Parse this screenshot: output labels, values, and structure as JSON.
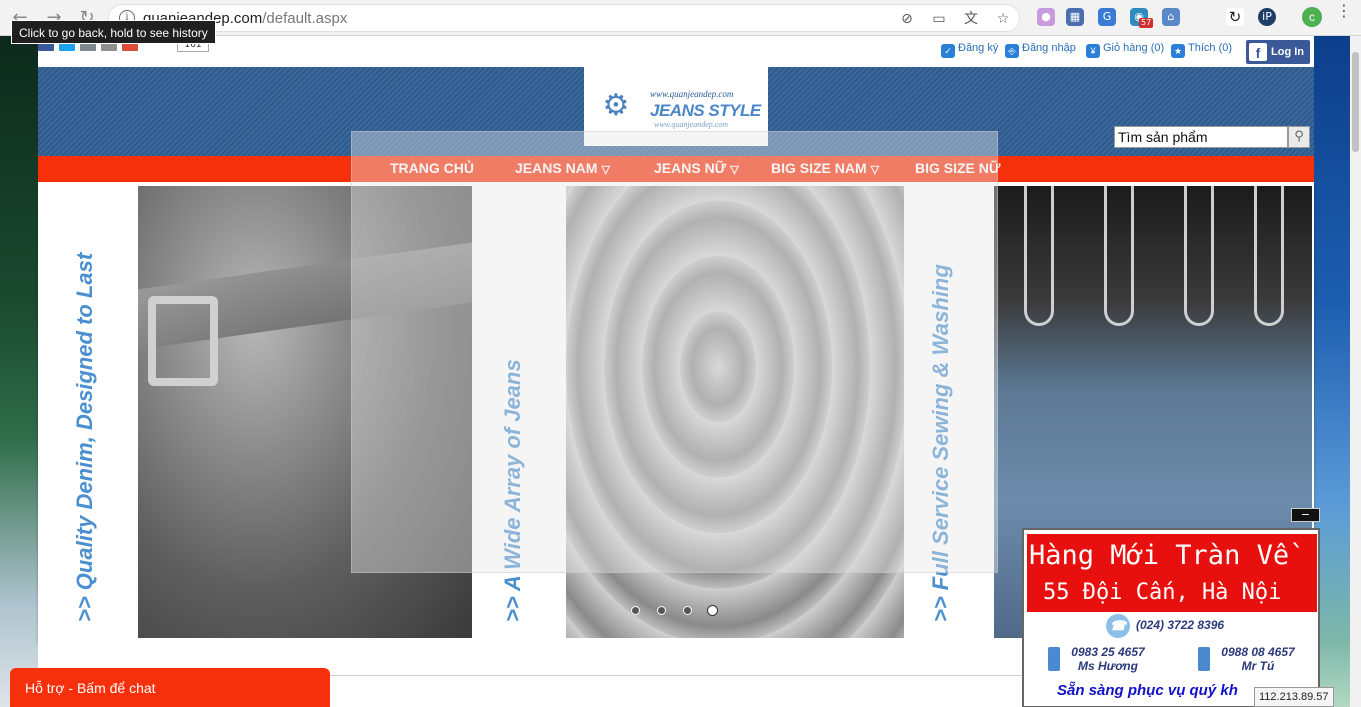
{
  "browser": {
    "url_domain": "quanjeandep.com",
    "url_path": "/default.aspx",
    "tooltip": "Click to go back, hold to see history",
    "profile_initial": "c",
    "ext_badge": "57"
  },
  "topbar": {
    "share_count": "161",
    "links": [
      {
        "label": "Đăng ký"
      },
      {
        "label": "Đăng nhập"
      },
      {
        "label": "Giỏ hàng (0)"
      },
      {
        "label": "Thích (0)"
      }
    ],
    "fb_login": "Log In"
  },
  "logo": {
    "url_top": "www.quanjeandep.com",
    "name": "JEANS STYLE",
    "url_bottom": "www.quanjeandep.com"
  },
  "search": {
    "placeholder": "Tìm sản phẩm"
  },
  "nav": {
    "items": [
      {
        "label": "TRANG CHỦ"
      },
      {
        "label": "JEANS NAM"
      },
      {
        "label": "JEANS NỮ"
      },
      {
        "label": "BIG SIZE NAM"
      },
      {
        "label": "BIG SIZE NỮ"
      }
    ]
  },
  "slider": {
    "captions": [
      ">> Quality Denim, Designed to Last",
      ">> A Wide Array of Jeans",
      ">> Full Service Sewing & Washing"
    ],
    "dots_total": 4,
    "active_dot": 4
  },
  "contact": {
    "promo_line1": "Hàng Mới Tràn Về",
    "promo_line2": "55 Đội Cấn, Hà Nội",
    "landline": "(024) 3722 8396",
    "mobiles": [
      {
        "number": "0983 25 4657",
        "name": "Ms Hương"
      },
      {
        "number": "0988 08 4657",
        "name": "Mr Tú"
      }
    ],
    "slogan": "Sẵn sàng phục vụ quý kh",
    "close_symbol": "−"
  },
  "ip": "112.213.89.57",
  "chat": {
    "label": "Hỗ trợ - Bấm để chat"
  },
  "colors": {
    "brand_red": "#f6300a",
    "link_blue": "#2a6fb5",
    "fb_blue": "#3b5998"
  }
}
